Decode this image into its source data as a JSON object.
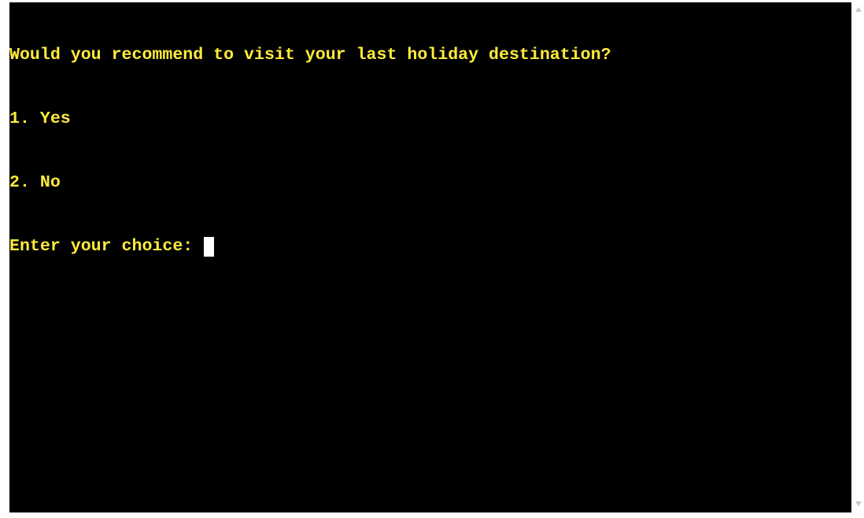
{
  "terminal": {
    "text_color": "#ffeb3b",
    "background_color": "#000000",
    "cursor_color": "#ffffff",
    "lines": [
      "Would you recommend to visit your last holiday destination?",
      "1. Yes",
      "2. No"
    ],
    "prompt": "Enter your choice: ",
    "input_value": ""
  },
  "scrollbar": {
    "up_icon": "scroll-up-arrow-icon",
    "down_icon": "scroll-down-arrow-icon"
  }
}
